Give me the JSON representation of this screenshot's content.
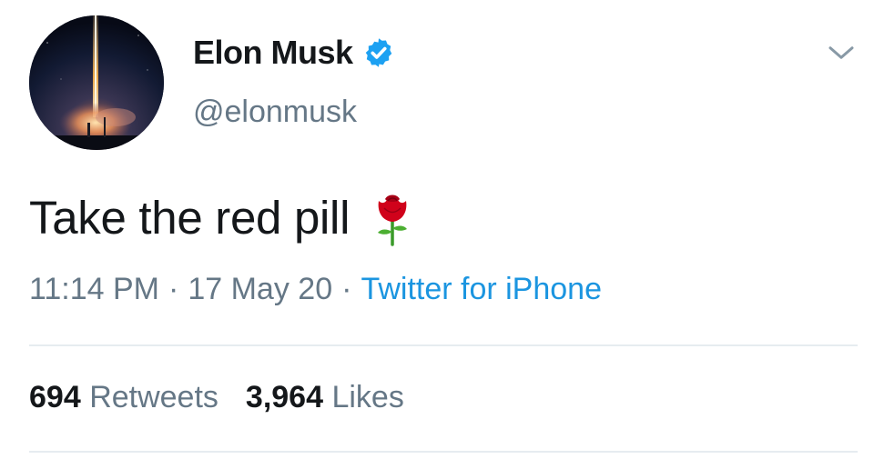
{
  "profile": {
    "display_name": "Elon Musk",
    "handle": "@elonmusk",
    "verified": true,
    "avatar": "rocket-launch-night-sky"
  },
  "tweet": {
    "text": "Take the red pill",
    "emoji": "rose-icon",
    "time": "11:14 PM",
    "date": "17 May 20",
    "separator": "·",
    "source": "Twitter for iPhone"
  },
  "stats": {
    "retweets_count": "694",
    "retweets_label": "Retweets",
    "likes_count": "3,964",
    "likes_label": "Likes"
  },
  "colors": {
    "text_primary": "#14171a",
    "text_secondary": "#657786",
    "link": "#1b95e0",
    "verified_badge": "#1da1f2",
    "rose_red": "#d0021b",
    "divider": "#e6ecf0"
  },
  "icons": {
    "verified": "verified-badge-icon",
    "more": "chevron-down-icon",
    "emoji": "rose-icon"
  }
}
